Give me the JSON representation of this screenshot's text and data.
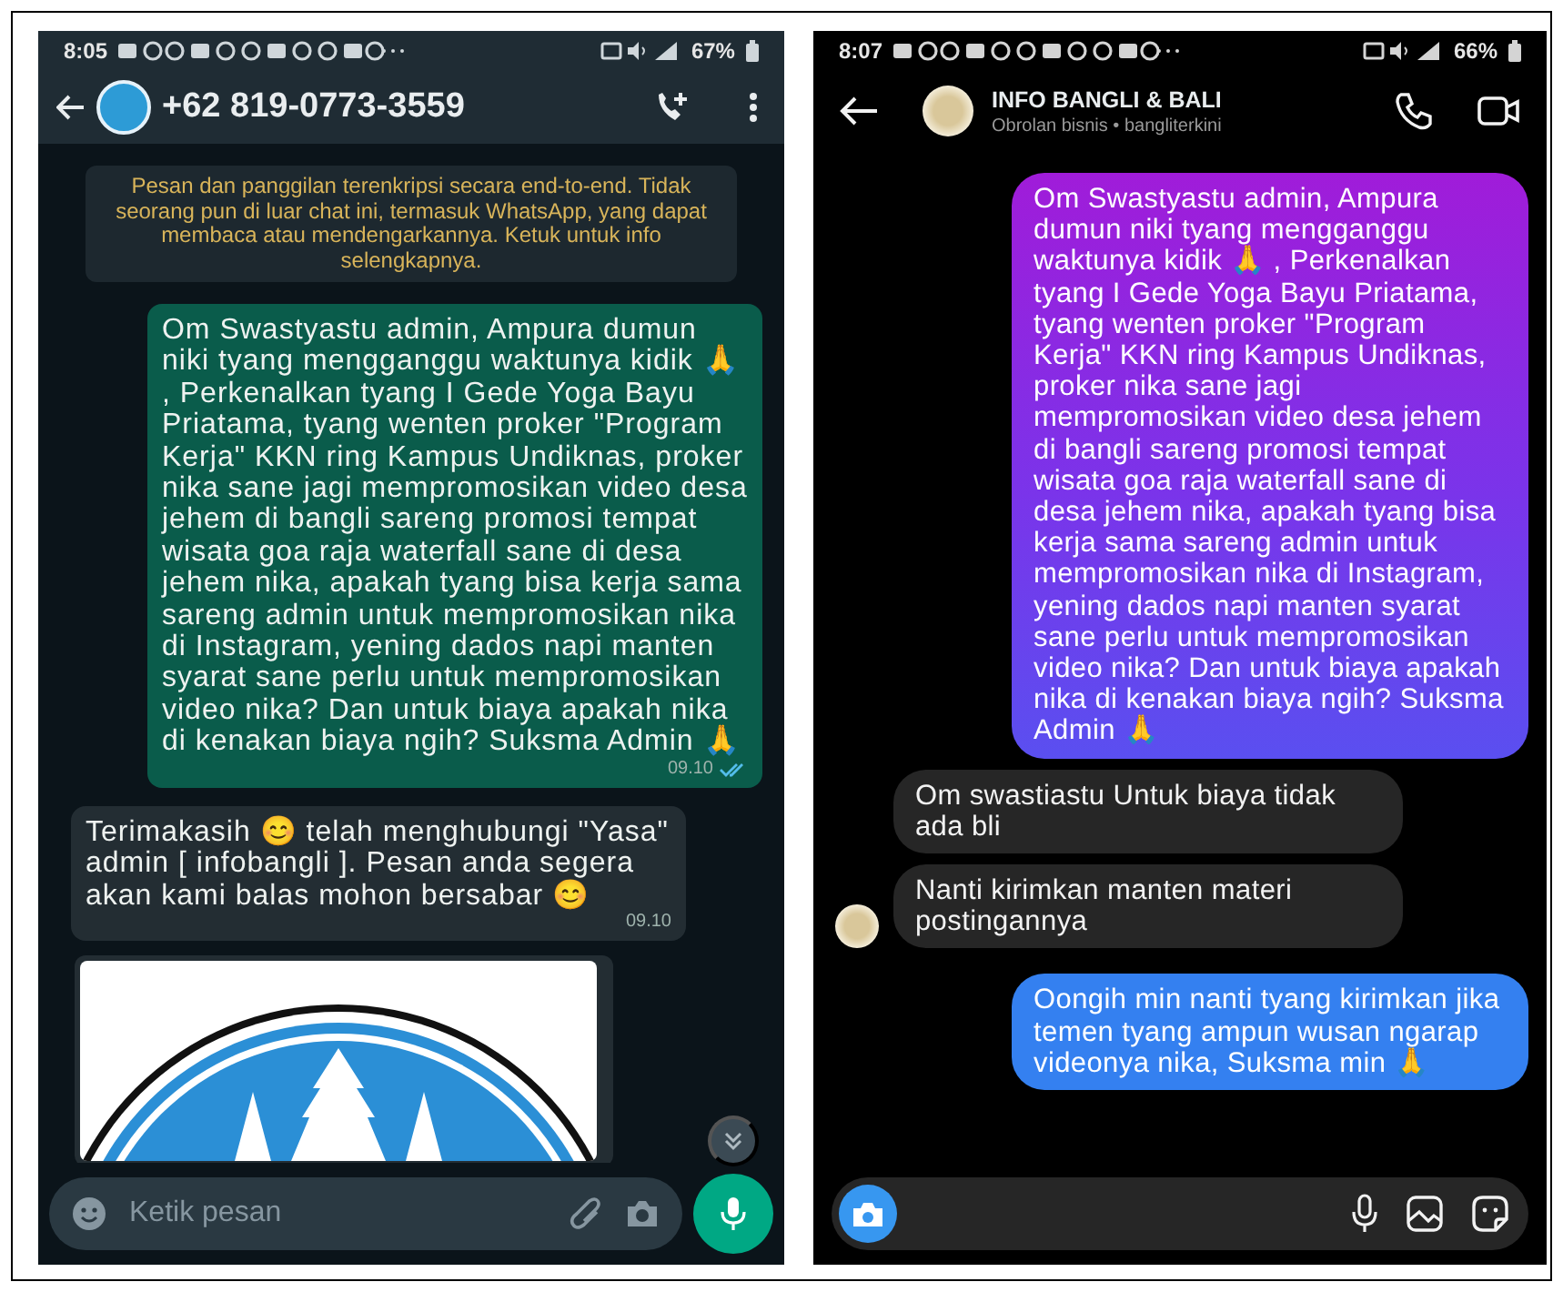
{
  "whatsapp": {
    "status_bar": {
      "time": "8:05",
      "battery": "67%"
    },
    "header": {
      "title": "+62 819-0773-3559"
    },
    "encryption_notice": "Pesan dan panggilan terenkripsi secara end-to-end. Tidak seorang pun di luar chat ini, termasuk WhatsApp, yang dapat membaca atau mendengarkannya. Ketuk untuk info selengkapnya.",
    "messages": [
      {
        "kind": "outgoing",
        "text": "Om Swastyastu admin, Ampura dumun niki tyang mengganggu waktunya kidik 🙏 , Perkenalkan tyang I Gede Yoga Bayu Priatama, tyang wenten proker \"Program Kerja\" KKN ring Kampus Undiknas, proker nika sane jagi mempromosikan video desa jehem di bangli sareng promosi tempat wisata goa raja waterfall sane di desa jehem nika, apakah tyang bisa kerja sama sareng admin untuk mempromosikan nika di Instagram, yening dados napi manten syarat sane perlu untuk mempromosikan video nika? Dan untuk biaya apakah nika di kenakan biaya ngih? Suksma Admin 🙏",
        "time": "09.10",
        "read": true
      },
      {
        "kind": "incoming",
        "text": "Terimakasih 😊 telah menghubungi \"Yasa\" admin [ infobangli ]. Pesan anda segera akan kami balas mohon bersabar 😊",
        "time": "09.10"
      },
      {
        "kind": "image"
      }
    ],
    "composer": {
      "placeholder": "Ketik pesan"
    }
  },
  "instagram": {
    "status_bar": {
      "time": "8:07",
      "battery": "66%"
    },
    "header": {
      "title": "INFO BANGLI & BALI",
      "subtitle": "Obrolan bisnis • bangliterkini"
    },
    "messages": [
      {
        "kind": "outgoing",
        "text": "Om Swastyastu admin, Ampura dumun niki tyang mengganggu waktunya kidik 🙏 , Perkenalkan tyang I Gede Yoga Bayu Priatama, tyang wenten proker \"Program Kerja\" KKN ring Kampus Undiknas, proker nika sane jagi mempromosikan video desa jehem di bangli sareng promosi tempat wisata goa raja waterfall sane di desa jehem nika, apakah tyang bisa kerja sama sareng admin untuk mempromosikan nika di Instagram, yening dados napi manten syarat sane perlu untuk mempromosikan video nika? Dan untuk biaya apakah nika di kenakan biaya ngih? Suksma Admin 🙏"
      },
      {
        "kind": "incoming",
        "avatar": false,
        "text": "Om swastiastu Untuk biaya tidak ada bli"
      },
      {
        "kind": "incoming",
        "avatar": true,
        "text": "Nanti kirimkan manten materi postingannya"
      },
      {
        "kind": "outgoing",
        "text": "Oongih min nanti tyang kirimkan jika temen tyang ampun wusan ngarap videonya nika, Suksma min 🙏"
      }
    ]
  }
}
